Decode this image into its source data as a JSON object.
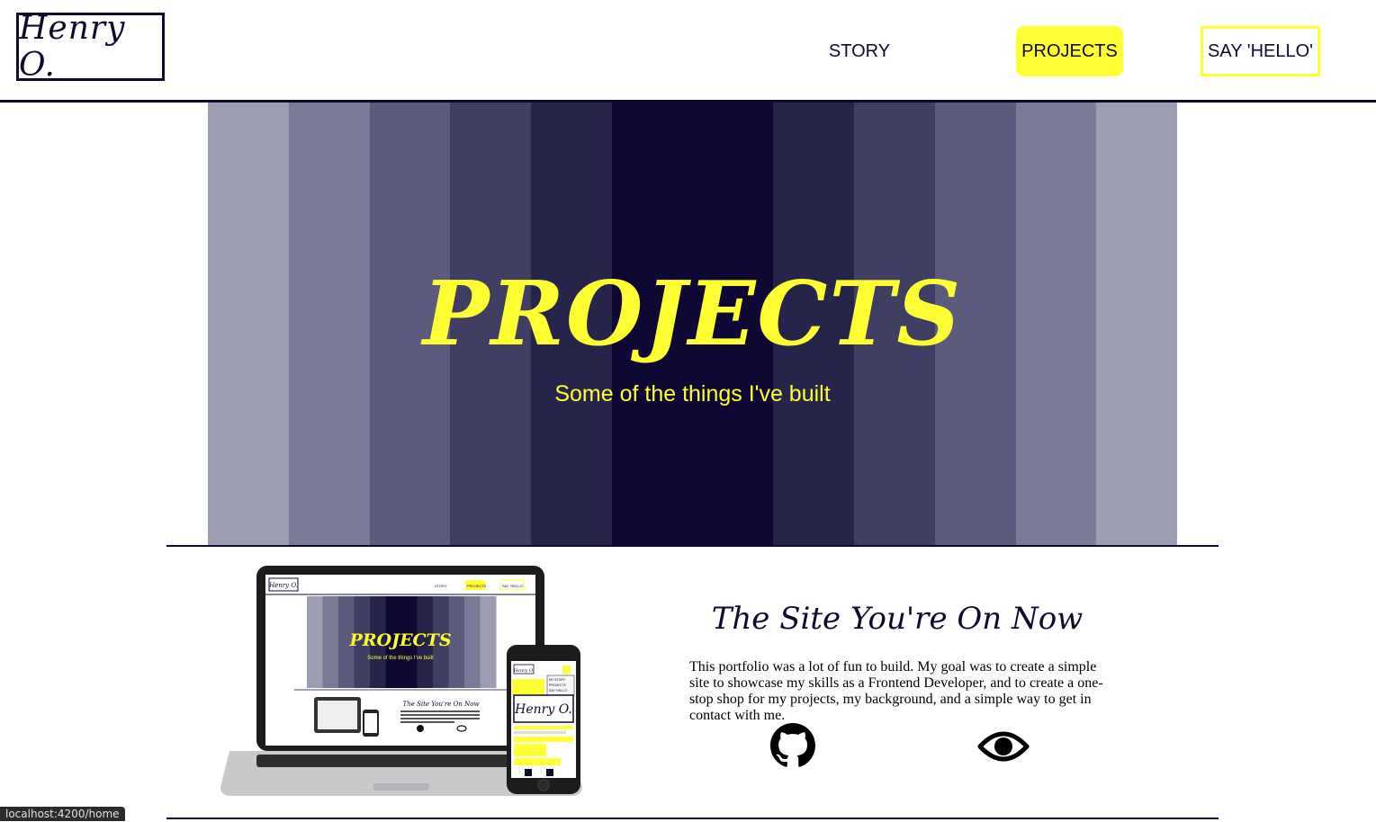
{
  "header": {
    "logo": "Henry O.",
    "nav": {
      "story": "STORY",
      "projects": "PROJECTS",
      "hello": "SAY 'HELLO'"
    }
  },
  "hero": {
    "title": "PROJECTS",
    "subtitle": "Some of the things I've built",
    "stripe_colors": [
      "#9c9cb3",
      "#7a7a97",
      "#5d5b7d",
      "#403f63",
      "#27244b",
      "#0f0834",
      "#0f0834",
      "#27244b",
      "#403f63",
      "#5d5b7d",
      "#7a7a97",
      "#9c9cb3"
    ]
  },
  "project": {
    "title": "The Site You're On Now",
    "description": "This portfolio was a lot of fun to build. My goal was to create a simple site to showcase my skills as a Frontend Developer, and to create a one-stop shop for my projects, my background, and a simple way to get in contact with me.",
    "mockup": {
      "laptop": {
        "logo": "Henry O.",
        "nav_story": "STORY",
        "nav_projects": "PROJECTS",
        "nav_hello": "SAY 'HELLO'",
        "title": "PROJECTS",
        "subtitle": "Some of the things I've built",
        "project_title": "The Site You're On Now"
      },
      "phone": {
        "logo": "Henry O.",
        "menu_story": "MY STORY",
        "menu_projects": "PROJECTS",
        "menu_hello": "SAY 'HELLO'"
      }
    },
    "links": {
      "github": "github-icon",
      "view": "eye-icon"
    }
  },
  "colors": {
    "navy": "#0e0a2e",
    "accent": "#ffff33"
  },
  "status_url": "localhost:4200/home"
}
